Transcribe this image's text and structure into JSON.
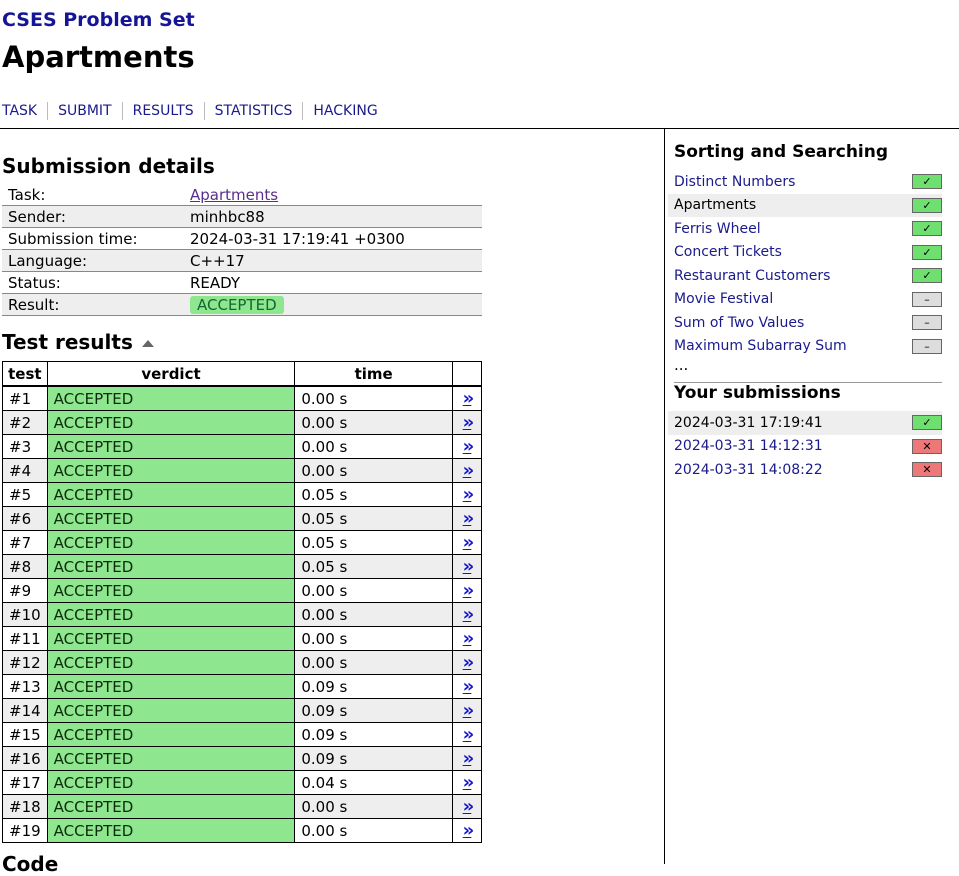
{
  "site": {
    "title": "CSES Problem Set"
  },
  "page": {
    "title": "Apartments"
  },
  "nav": [
    "TASK",
    "SUBMIT",
    "RESULTS",
    "STATISTICS",
    "HACKING"
  ],
  "details": {
    "heading": "Submission details",
    "rows": [
      {
        "key": "Task:",
        "value": "Apartments"
      },
      {
        "key": "Sender:",
        "value": "minhbc88"
      },
      {
        "key": "Submission time:",
        "value": "2024-03-31 17:19:41 +0300"
      },
      {
        "key": "Language:",
        "value": "C++17"
      },
      {
        "key": "Status:",
        "value": "READY"
      },
      {
        "key": "Result:",
        "value": "ACCEPTED"
      }
    ]
  },
  "tests": {
    "heading": "Test results",
    "columns": [
      "test",
      "verdict",
      "time",
      ""
    ],
    "arrow": "»",
    "rows": [
      {
        "test": "#1",
        "verdict": "ACCEPTED",
        "time": "0.00 s"
      },
      {
        "test": "#2",
        "verdict": "ACCEPTED",
        "time": "0.00 s"
      },
      {
        "test": "#3",
        "verdict": "ACCEPTED",
        "time": "0.00 s"
      },
      {
        "test": "#4",
        "verdict": "ACCEPTED",
        "time": "0.00 s"
      },
      {
        "test": "#5",
        "verdict": "ACCEPTED",
        "time": "0.05 s"
      },
      {
        "test": "#6",
        "verdict": "ACCEPTED",
        "time": "0.05 s"
      },
      {
        "test": "#7",
        "verdict": "ACCEPTED",
        "time": "0.05 s"
      },
      {
        "test": "#8",
        "verdict": "ACCEPTED",
        "time": "0.05 s"
      },
      {
        "test": "#9",
        "verdict": "ACCEPTED",
        "time": "0.00 s"
      },
      {
        "test": "#10",
        "verdict": "ACCEPTED",
        "time": "0.00 s"
      },
      {
        "test": "#11",
        "verdict": "ACCEPTED",
        "time": "0.00 s"
      },
      {
        "test": "#12",
        "verdict": "ACCEPTED",
        "time": "0.00 s"
      },
      {
        "test": "#13",
        "verdict": "ACCEPTED",
        "time": "0.09 s"
      },
      {
        "test": "#14",
        "verdict": "ACCEPTED",
        "time": "0.09 s"
      },
      {
        "test": "#15",
        "verdict": "ACCEPTED",
        "time": "0.09 s"
      },
      {
        "test": "#16",
        "verdict": "ACCEPTED",
        "time": "0.09 s"
      },
      {
        "test": "#17",
        "verdict": "ACCEPTED",
        "time": "0.04 s"
      },
      {
        "test": "#18",
        "verdict": "ACCEPTED",
        "time": "0.00 s"
      },
      {
        "test": "#19",
        "verdict": "ACCEPTED",
        "time": "0.00 s"
      }
    ]
  },
  "sidebar": {
    "section_title": "Sorting and Searching",
    "tasks": [
      {
        "name": "Distinct Numbers",
        "status": "ok",
        "icon": "✓"
      },
      {
        "name": "Apartments",
        "status": "ok",
        "icon": "✓",
        "current": true
      },
      {
        "name": "Ferris Wheel",
        "status": "ok",
        "icon": "✓"
      },
      {
        "name": "Concert Tickets",
        "status": "ok",
        "icon": "✓"
      },
      {
        "name": "Restaurant Customers",
        "status": "ok",
        "icon": "✓"
      },
      {
        "name": "Movie Festival",
        "status": "none",
        "icon": "–"
      },
      {
        "name": "Sum of Two Values",
        "status": "none",
        "icon": "–"
      },
      {
        "name": "Maximum Subarray Sum",
        "status": "none",
        "icon": "–"
      }
    ],
    "more": "...",
    "submissions_title": "Your submissions",
    "submissions": [
      {
        "time": "2024-03-31 17:19:41",
        "status": "ok",
        "icon": "✓",
        "current": true
      },
      {
        "time": "2024-03-31 14:12:31",
        "status": "fail",
        "icon": "✕"
      },
      {
        "time": "2024-03-31 14:08:22",
        "status": "fail",
        "icon": "✕"
      }
    ]
  },
  "colors": {
    "accepted": "#8ee78e",
    "ok_box": "#6fe06f",
    "fail_box": "#ee7777",
    "link": "#1a1a8c"
  },
  "bottom_partial": "Code"
}
